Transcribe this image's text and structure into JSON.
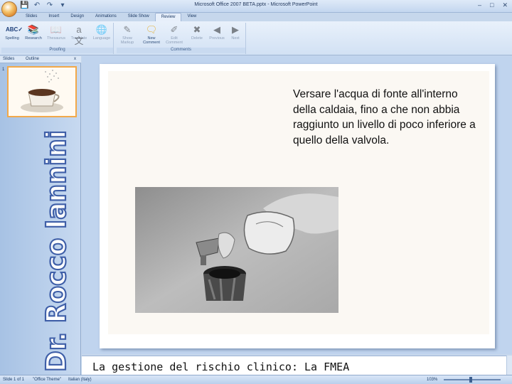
{
  "window": {
    "title": "Microsoft Office 2007 BETA.pptx - Microsoft PowerPoint",
    "controls": [
      "–",
      "□",
      "✕"
    ]
  },
  "quick_access": [
    "💾",
    "↶",
    "↷",
    "▾"
  ],
  "tabs": [
    "Slides",
    "Insert",
    "Design",
    "Animations",
    "Slide Show",
    "Review",
    "View"
  ],
  "active_tab": "Review",
  "ribbon": {
    "proofing": {
      "label": "Proofing",
      "buttons": [
        {
          "label": "Spelling",
          "icon": "spelling-icon"
        },
        {
          "label": "Research",
          "icon": "research-icon"
        },
        {
          "label": "Thesaurus",
          "icon": "thesaurus-icon"
        },
        {
          "label": "Translate",
          "icon": "translate-icon"
        },
        {
          "label": "Language",
          "icon": "language-icon"
        }
      ]
    },
    "comments": {
      "label": "Comments",
      "buttons": [
        {
          "label": "Show Markup",
          "icon": "show-markup-icon"
        },
        {
          "label": "New Comment",
          "icon": "new-comment-icon"
        },
        {
          "label": "Edit Comment",
          "icon": "edit-comment-icon"
        },
        {
          "label": "Delete",
          "icon": "delete-icon"
        },
        {
          "label": "Previous",
          "icon": "previous-icon"
        },
        {
          "label": "Next",
          "icon": "next-icon"
        }
      ]
    }
  },
  "left_pane": {
    "tabs": [
      "Slides",
      "Outline"
    ],
    "close": "x",
    "thumbnail_number": "1",
    "watermark": "Dr. Rocco Iannini"
  },
  "slide": {
    "text": "Versare l'acqua di fonte all'interno della caldaia, fino a che non abbia raggiunto un livello di poco inferiore a quello della valvola."
  },
  "notes": {
    "text": "La gestione del rischio clinico: La FMEA"
  },
  "status_bar": {
    "slide_info": "Slide 1 of 1",
    "theme": "\"Office Theme\"",
    "language": "Italian (Italy)",
    "zoom": "103%"
  },
  "colors": {
    "accent": "#f2a94a",
    "ribbon": "#dbe7f6",
    "watermark": "#3f5fa8"
  }
}
